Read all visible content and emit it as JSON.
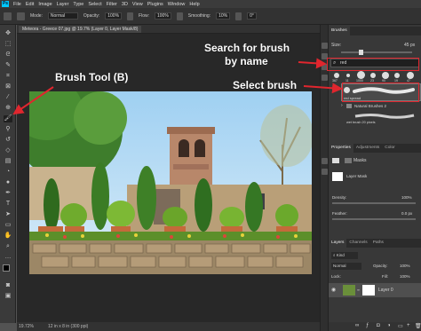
{
  "menubar": {
    "items": [
      "File",
      "Edit",
      "Image",
      "Layer",
      "Type",
      "Select",
      "Filter",
      "3D",
      "View",
      "Plugins",
      "Window",
      "Help"
    ]
  },
  "options_bar": {
    "mode_label": "Mode:",
    "mode_value": "Normal",
    "opacity_label": "Opacity:",
    "opacity_value": "100%",
    "flow_label": "Flow:",
    "flow_value": "100%",
    "smoothing_label": "Smoothing:",
    "smoothing_value": "10%",
    "angle_value": "0°"
  },
  "document": {
    "tab_title": "Meteora - Greece 07.jpg @ 19.7% (Layer 0, Layer Mask/8)",
    "status_zoom": "19.72%",
    "status_dims": "12 in x 8 in (300 ppi)"
  },
  "brushes_panel": {
    "tab": "Brushes",
    "size_label": "Size:",
    "size_value": "45 px",
    "search_value": "red",
    "preset_sizes": [
      "367",
      "11",
      "1000",
      "23",
      "90",
      "19",
      "47"
    ],
    "selected_brush_name": "red spread",
    "group_name": "Natural Brushes 2",
    "group_item_name": "wet brush 20 pixels"
  },
  "properties_panel": {
    "tabs": [
      "Properties",
      "Adjustments",
      "Color"
    ],
    "masks_label": "Masks",
    "layer_mask_label": "Layer Mask",
    "density_label": "Density:",
    "density_value": "100%",
    "feather_label": "Feather:",
    "feather_value": "0.0 px"
  },
  "layers_panel": {
    "tabs": [
      "Layers",
      "Channels",
      "Paths"
    ],
    "kind_label": "Kind",
    "blend_mode": "Normal",
    "opacity_label": "Opacity:",
    "opacity_value": "100%",
    "lock_label": "Lock:",
    "fill_label": "Fill:",
    "fill_value": "100%",
    "layer_name": "Layer 0"
  },
  "annotations": {
    "brush_tool": "Brush Tool (B)",
    "search_line1": "Search for brush",
    "search_line2": "by name",
    "select_brush": "Select brush",
    "color": "#e0262e"
  }
}
